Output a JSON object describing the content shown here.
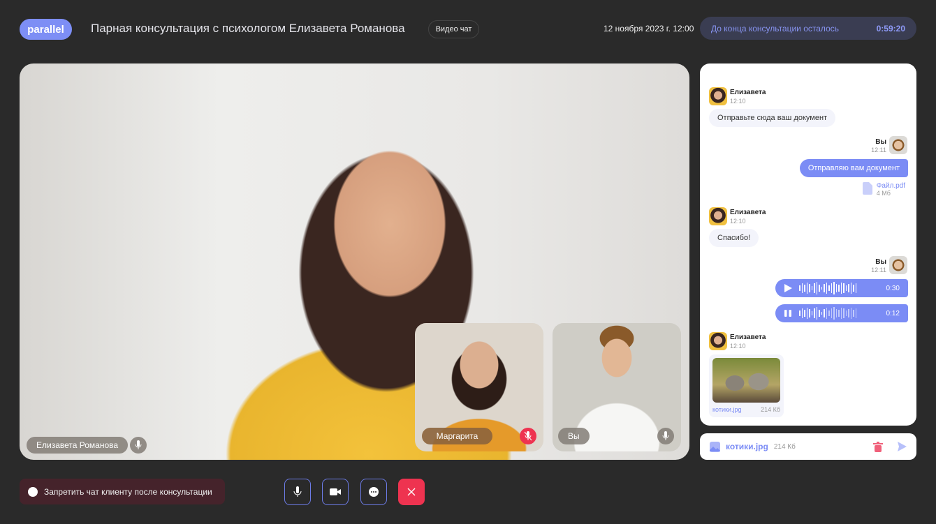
{
  "header": {
    "logo": "parallel",
    "title": "Парная консультация с психологом Елизавета Романова",
    "badge": "Видео чат",
    "date": "12 ноября 2023 г. 12:00",
    "timer_label": "До конца консультации осталось",
    "timer_value": "0:59:20"
  },
  "video": {
    "main_name": "Елизавета Романова",
    "tiles": [
      {
        "name": "Маргарита",
        "muted": true
      },
      {
        "name": "Вы",
        "muted": false
      }
    ]
  },
  "chat": {
    "messages": [
      {
        "author": "Елизавета",
        "time": "12:10",
        "text": "Отправьте сюда ваш документ"
      },
      {
        "author": "Вы",
        "time": "12:11",
        "text": "Отправляю вам документ",
        "file_name": "Файл.pdf",
        "file_size": "4 Мб"
      },
      {
        "author": "Елизавета",
        "time": "12:10",
        "text": "Спасибо!"
      },
      {
        "author": "Вы",
        "time": "12:11",
        "audio": [
          {
            "duration": "0:30",
            "state": "paused"
          },
          {
            "duration": "0:12",
            "state": "playing"
          }
        ]
      },
      {
        "author": "Елизавета",
        "time": "12:10",
        "file_name": "котики.jpg",
        "file_size": "214 Кб"
      }
    ]
  },
  "composer": {
    "file_name": "котики.jpg",
    "file_size": "214 Кб"
  },
  "footer": {
    "ban_label": "Запретить чат клиенту после консультации"
  },
  "colors": {
    "accent": "#7b8cf5",
    "danger": "#ee3350",
    "bg": "#2a2a2a"
  }
}
